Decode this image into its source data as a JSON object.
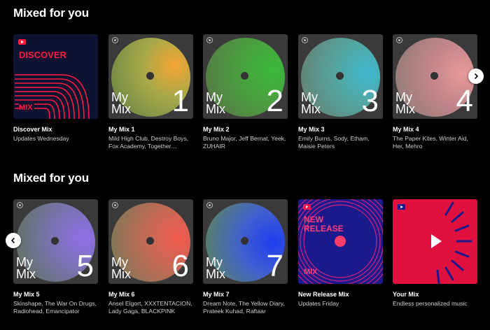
{
  "sections": [
    {
      "title": "Mixed for you",
      "cards": [
        {
          "title": "Discover Mix",
          "subtitle": "Updates Wednesday",
          "art_word1": "DISCOVER",
          "art_word2": "MIX"
        },
        {
          "title": "My Mix 1",
          "subtitle": "Mild High Club, Destroy Boys, Fox Academy, Together…",
          "art_label": "My Mix",
          "art_number": "1"
        },
        {
          "title": "My Mix 2",
          "subtitle": "Bruno Major, Jeff Bernat, Yeek, ZUHAIR",
          "art_label": "My Mix",
          "art_number": "2"
        },
        {
          "title": "My Mix 3",
          "subtitle": "Emily Burns, Sody, Etham, Maisie Peters",
          "art_label": "My Mix",
          "art_number": "3"
        },
        {
          "title": "My Mix 4",
          "subtitle": "The Paper Kites, Winter Aid, Her, Mehro",
          "art_label": "My Mix",
          "art_number": "4"
        }
      ]
    },
    {
      "title": "Mixed for you",
      "cards": [
        {
          "title": "My Mix 5",
          "subtitle": "Skinshape, The War On Drugs, Radiohead, Emancipator",
          "art_label": "My Mix",
          "art_number": "5"
        },
        {
          "title": "My Mix 6",
          "subtitle": "Ansel Elgort, XXXTENTACION, Lady Gaga, BLACKPINK",
          "art_label": "My Mix",
          "art_number": "6"
        },
        {
          "title": "My Mix 7",
          "subtitle": "Dream Note, The Yellow Diary, Prateek Kuhad, Raftaar",
          "art_label": "My Mix",
          "art_number": "7"
        },
        {
          "title": "New Release Mix",
          "subtitle": "Updates Friday",
          "art_word1": "NEW",
          "art_word2": "RELEASE",
          "art_word3": "MIX"
        },
        {
          "title": "Your Mix",
          "subtitle": "Endless personalized music"
        }
      ]
    }
  ],
  "nav": {
    "next_icon": "chevron-right-icon",
    "prev_icon": "chevron-left-icon"
  },
  "colors": {
    "background": "#000000",
    "accent_red": "#ff1a3d",
    "discover_bg": "#0d1330",
    "new_release_bg": "#1a1a8c",
    "your_mix_bg": "#e0103f"
  }
}
